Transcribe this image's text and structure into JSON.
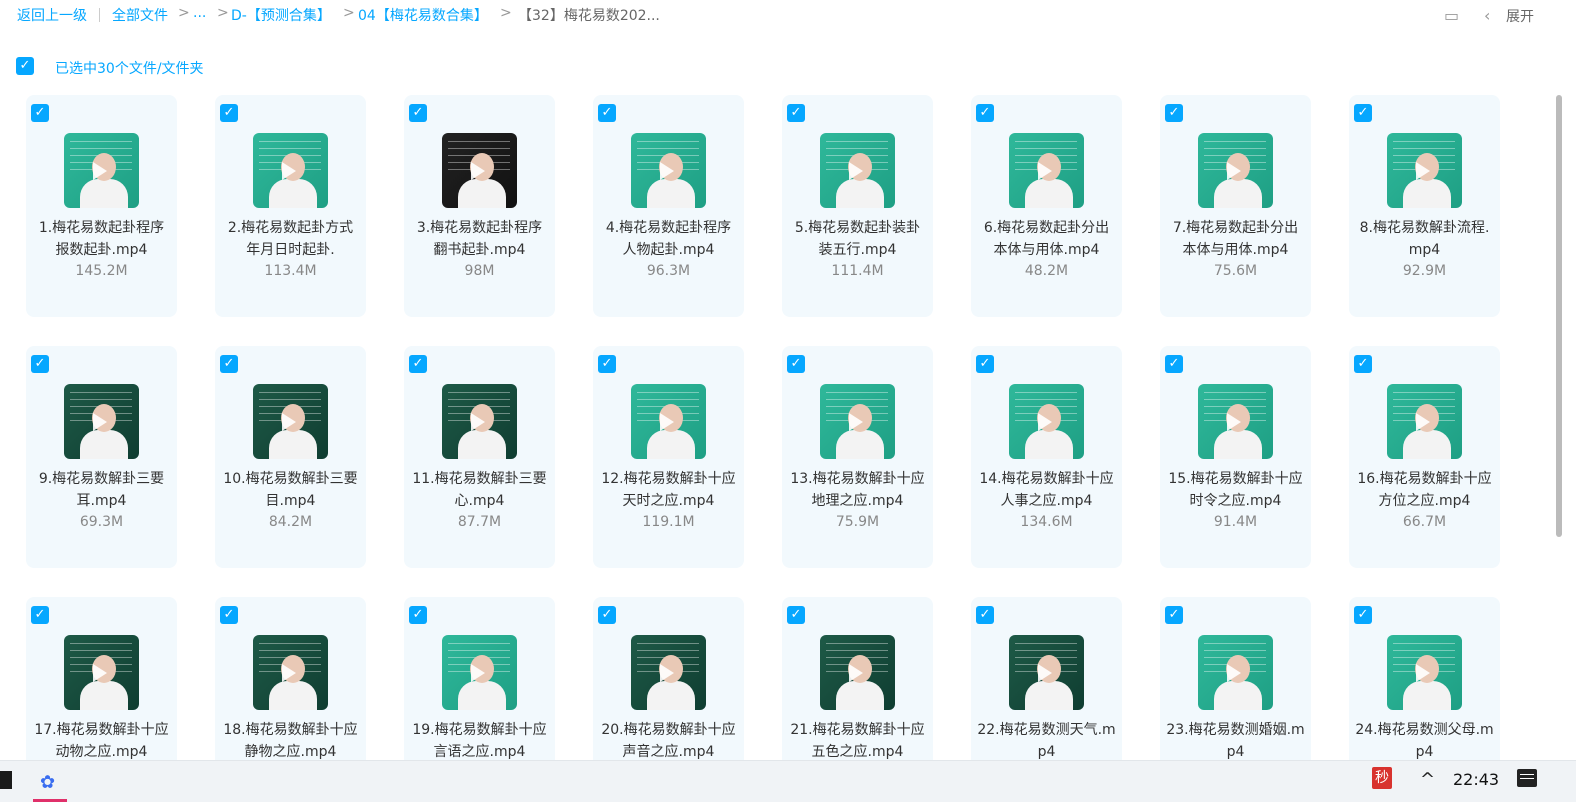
{
  "breadcrumb": {
    "back": "返回上一级",
    "all_files": "全部文件",
    "ellipsis": "...",
    "level1": "D-【预测合集】",
    "level2": "04【梅花易数合集】",
    "current": "【32】梅花易数202..."
  },
  "toolbar": {
    "expand_label": "展开"
  },
  "selection": {
    "text": "已选中30个文件/文件夹",
    "checkbox_icon": "check-icon"
  },
  "colors": {
    "accent": "#06a7ff",
    "card_bg": "#f2f9fd",
    "thumb_green": "#2fb89a"
  },
  "files": [
    {
      "name": "1.梅花易数起卦程序报数起卦.mp4",
      "display": "1.梅花易数起卦程序报数起卦.mp4",
      "size": "145.2M"
    },
    {
      "name": "2.梅花易数起卦方式年月日时起卦.",
      "display": "2.梅花易数起卦方式年月日时起卦.",
      "size": "113.4M"
    },
    {
      "name": "3.梅花易数起卦程序翻书起卦.mp4",
      "display": "3.梅花易数起卦程序翻书起卦.mp4",
      "size": "98M"
    },
    {
      "name": "4.梅花易数起卦程序人物起卦.mp4",
      "display": "4.梅花易数起卦程序人物起卦.mp4",
      "size": "96.3M"
    },
    {
      "name": "5.梅花易数起卦装卦装五行.mp4",
      "display": "5.梅花易数起卦装卦装五行.mp4",
      "size": "111.4M"
    },
    {
      "name": "6.梅花易数起卦分出本体与用体.mp4",
      "display": "6.梅花易数起卦分出本体与用体.mp4",
      "size": "48.2M"
    },
    {
      "name": "7.梅花易数起卦分出本体与用体.mp4",
      "display": "7.梅花易数起卦分出本体与用体.mp4",
      "size": "75.6M"
    },
    {
      "name": "8.梅花易数解卦流程.mp4",
      "display": "8.梅花易数解卦流程.mp4",
      "size": "92.9M"
    },
    {
      "name": "9.梅花易数解卦三要耳.mp4",
      "display": "9.梅花易数解卦三要耳.mp4",
      "size": "69.3M"
    },
    {
      "name": "10.梅花易数解卦三要目.mp4",
      "display": "10.梅花易数解卦三要目.mp4",
      "size": "84.2M"
    },
    {
      "name": "11.梅花易数解卦三要心.mp4",
      "display": "11.梅花易数解卦三要心.mp4",
      "size": "87.7M"
    },
    {
      "name": "12.梅花易数解卦十应天时之应.mp4",
      "display": "12.梅花易数解卦十应天时之应.mp4",
      "size": "119.1M"
    },
    {
      "name": "13.梅花易数解卦十应地理之应.mp4",
      "display": "13.梅花易数解卦十应地理之应.mp4",
      "size": "75.9M"
    },
    {
      "name": "14.梅花易数解卦十应人事之应.mp4",
      "display": "14.梅花易数解卦十应人事之应.mp4",
      "size": "134.6M"
    },
    {
      "name": "15.梅花易数解卦十应时令之应.mp4",
      "display": "15.梅花易数解卦十应时令之应.mp4",
      "size": "91.4M"
    },
    {
      "name": "16.梅花易数解卦十应方位之应.mp4",
      "display": "16.梅花易数解卦十应方位之应.mp4",
      "size": "66.7M"
    },
    {
      "name": "17.梅花易数解卦十应动物之应.mp4",
      "display": "17.梅花易数解卦十应动物之应.mp4",
      "size": ""
    },
    {
      "name": "18.梅花易数解卦十应静物之应.mp4",
      "display": "18.梅花易数解卦十应静物之应.mp4",
      "size": ""
    },
    {
      "name": "19.梅花易数解卦十应言语之应.mp4",
      "display": "19.梅花易数解卦十应言语之应.mp4",
      "size": ""
    },
    {
      "name": "20.梅花易数解卦十应声音之应.mp4",
      "display": "20.梅花易数解卦十应声音之应.mp4",
      "size": ""
    },
    {
      "name": "21.梅花易数解卦十应五色之应.mp4",
      "display": "21.梅花易数解卦十应五色之应.mp4",
      "size": ""
    },
    {
      "name": "22.梅花易数测天气.mp4",
      "display": "22.梅花易数测天气.mp4",
      "size": ""
    },
    {
      "name": "23.梅花易数测婚姻.mp4",
      "display": "23.梅花易数测婚姻.mp4",
      "size": ""
    },
    {
      "name": "24.梅花易数测父母.mp4",
      "display": "24.梅花易数测父母.mp4",
      "size": ""
    }
  ],
  "taskbar": {
    "clock": "22:43",
    "tray_app_label": "秒",
    "tray_up_icon": "chevron-up-icon",
    "notification_icon": "notification-icon"
  }
}
